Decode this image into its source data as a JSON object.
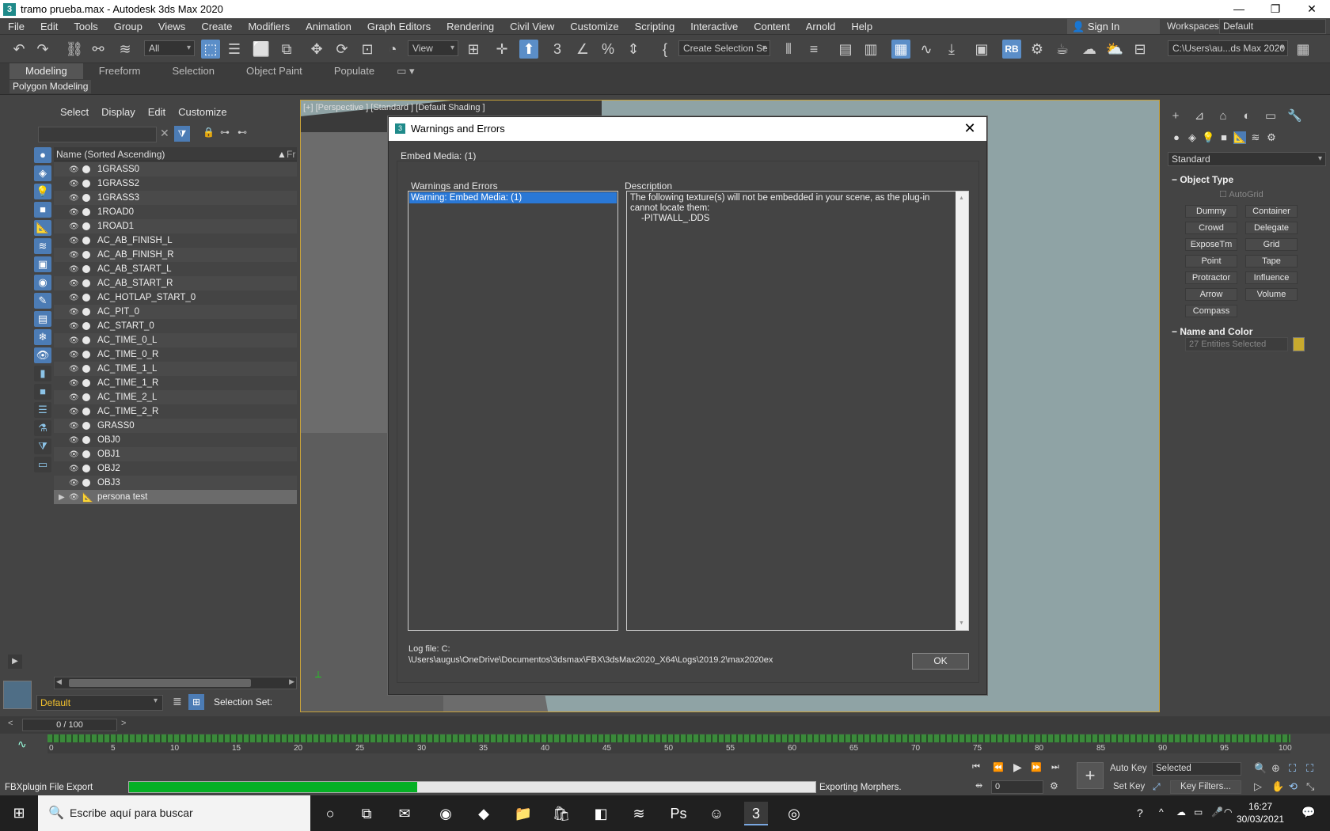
{
  "window": {
    "title": "tramo prueba.max - Autodesk 3ds Max 2020",
    "logo": "3"
  },
  "menu": [
    "File",
    "Edit",
    "Tools",
    "Group",
    "Views",
    "Create",
    "Modifiers",
    "Animation",
    "Graph Editors",
    "Rendering",
    "Civil View",
    "Customize",
    "Scripting",
    "Interactive",
    "Content",
    "Arnold",
    "Help"
  ],
  "account": {
    "sign_in": "Sign In",
    "workspaces_label": "Workspaces:",
    "workspace": "Default"
  },
  "toolbar": {
    "filter": "All",
    "ref_coord": "View",
    "named_selection": "Create Selection Se",
    "project_path": "C:\\Users\\au...ds Max 2020",
    "rb_label": "RB"
  },
  "ribbon": {
    "tabs": [
      "Modeling",
      "Freeform",
      "Selection",
      "Object Paint",
      "Populate"
    ],
    "active": "Modeling",
    "panel": "Polygon Modeling"
  },
  "explorer": {
    "menu": [
      "Select",
      "Display",
      "Edit",
      "Customize"
    ],
    "column_header": "Name (Sorted Ascending)",
    "column_header2": "Fr",
    "rows": [
      "1GRASS0",
      "1GRASS2",
      "1GRASS3",
      "1ROAD0",
      "1ROAD1",
      "AC_AB_FINISH_L",
      "AC_AB_FINISH_R",
      "AC_AB_START_L",
      "AC_AB_START_R",
      "AC_HOTLAP_START_0",
      "AC_PIT_0",
      "AC_START_0",
      "AC_TIME_0_L",
      "AC_TIME_0_R",
      "AC_TIME_1_L",
      "AC_TIME_1_R",
      "AC_TIME_2_L",
      "AC_TIME_2_R",
      "GRASS0",
      "OBJ0",
      "OBJ1",
      "OBJ2",
      "OBJ3",
      "persona test"
    ],
    "layer": "Default",
    "selection_set_label": "Selection Set:"
  },
  "viewport": {
    "label": "[+] [Perspective ] [Standard ] [Default Shading ]"
  },
  "dialog": {
    "title": "Warnings and Errors",
    "embed_media": "Embed Media: (1)",
    "list_header": "Warnings and Errors",
    "desc_header": "Description",
    "list_items": [
      "Warning: Embed Media: (1)"
    ],
    "description": "The following texture(s) will not be embedded in your scene, as the plug-in cannot locate them:",
    "missing_file": "-PITWALL_.DDS",
    "log_label": "Log file: C:",
    "log_path": "\\Users\\augus\\OneDrive\\Documentos\\3dsmax\\FBX\\3dsMax2020_X64\\Logs\\2019.2\\max2020ex",
    "ok": "OK"
  },
  "command_panel": {
    "category": "Standard",
    "object_type_title": "Object Type",
    "autogrid": "AutoGrid",
    "buttons": [
      "Dummy",
      "Container",
      "Crowd",
      "Delegate",
      "ExposeTm",
      "Grid",
      "Point",
      "Tape",
      "Protractor",
      "Influence",
      "Arrow",
      "Volume",
      "Compass"
    ],
    "name_color_title": "Name and Color",
    "entities": "27 Entities Selected",
    "swatch_color": "#c8aa2e"
  },
  "timeline": {
    "frame_display": "0 / 100",
    "ticks": [
      "0",
      "5",
      "10",
      "15",
      "20",
      "25",
      "30",
      "35",
      "40",
      "45",
      "50",
      "55",
      "60",
      "65",
      "70",
      "75",
      "80",
      "85",
      "90",
      "95",
      "100"
    ]
  },
  "status": {
    "plugin": "FBXplugin File Export",
    "progress": 0.42,
    "message": "Exporting Morphers.",
    "auto_key": "Auto Key",
    "set_key": "Set Key",
    "key_mode": "Selected",
    "key_filters": "Key Filters...",
    "current_frame": "0"
  },
  "taskbar": {
    "search_placeholder": "Escribe aquí para buscar",
    "time": "16:27",
    "date": "30/03/2021"
  }
}
